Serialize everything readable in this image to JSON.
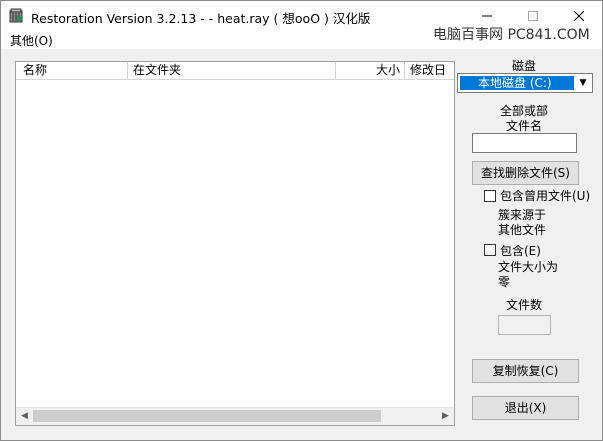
{
  "window": {
    "title": "Restoration Version 3.2.13   -  - heat.ray ( 想ooO ) 汉化版"
  },
  "menu": {
    "other": "其他(O)"
  },
  "watermark": "电脑百事网 PC841.COM",
  "list": {
    "columns": [
      "名称",
      "在文件夹",
      "大小",
      "修改日"
    ]
  },
  "right_panel": {
    "disk_label": "磁盘",
    "disk_selected": "本地磁盘 (C:)",
    "filename_label_line1": "全部或部",
    "filename_label_line2": "文件名",
    "filename_value": "",
    "find_button": "查找删除文件(S)",
    "include_used_label": "包含曾用文件(U)",
    "cluster_line1": "簇来源于",
    "cluster_line2": "其他文件",
    "include_label": "包含(E)",
    "size_zero_line1": "文件大小为",
    "size_zero_line2": "零",
    "file_count_label": "文件数",
    "file_count_value": "",
    "copy_restore_button": "复制恢复(C)",
    "exit_button": "退出(X)"
  }
}
